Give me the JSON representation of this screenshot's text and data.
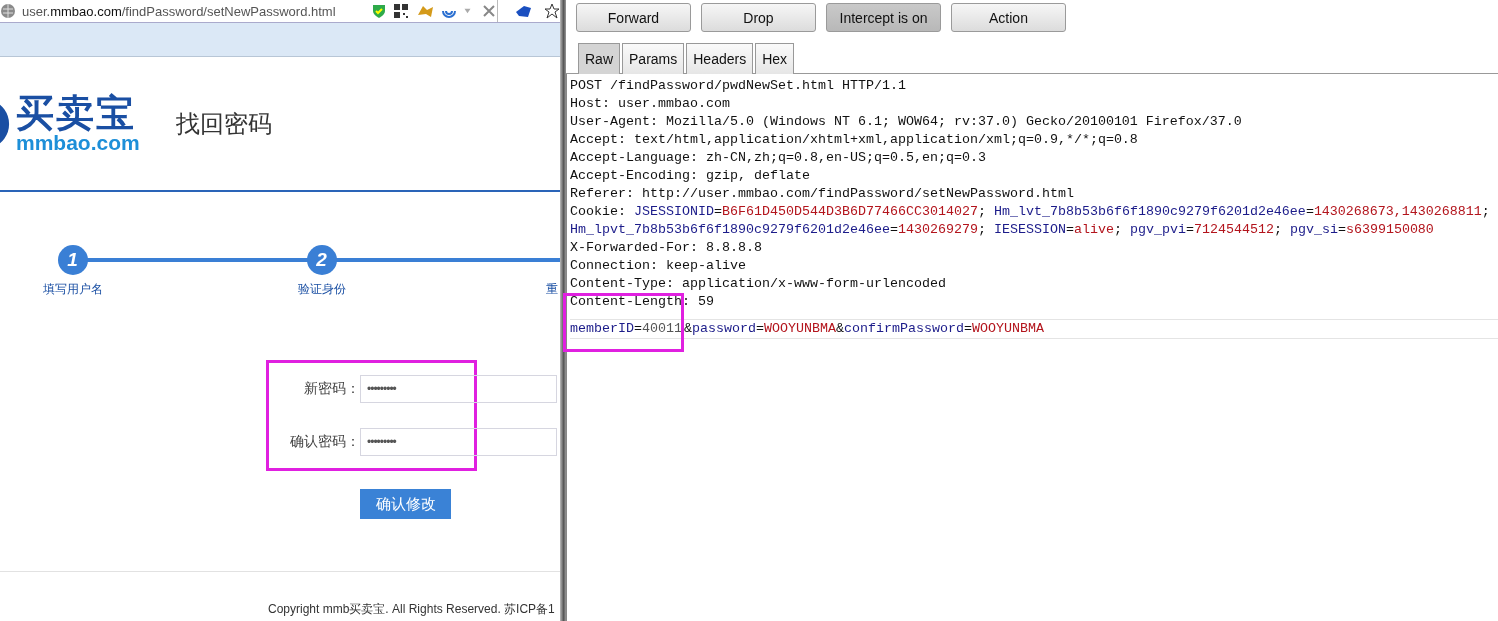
{
  "browser": {
    "url": "user.**mmbao.com**/findPassword/setNewPassword.html"
  },
  "page": {
    "logo": {
      "name": "买卖宝",
      "domain": "mmbao.com"
    },
    "heading": "找回密码",
    "steps": [
      {
        "number": "1",
        "label": "填写用户名"
      },
      {
        "number": "2",
        "label": "验证身份"
      },
      {
        "label": "重"
      }
    ],
    "form": {
      "highlighted": true,
      "fields": [
        {
          "label": "新密码：",
          "value": "•••••••••"
        },
        {
          "label": "确认密码：",
          "value": "•••••••••"
        }
      ],
      "submit": "确认修改"
    },
    "footer": "Copyright mmb买卖宝. All Rights Reserved. 苏ICP备1"
  },
  "proxy": {
    "buttons": [
      {
        "label": "Forward",
        "selected": false
      },
      {
        "label": "Drop",
        "selected": false
      },
      {
        "label": "Intercept is on",
        "selected": true
      },
      {
        "label": "Action",
        "selected": false
      }
    ],
    "tabs": [
      {
        "label": "Raw",
        "selected": true
      },
      {
        "label": "Params",
        "selected": false
      },
      {
        "label": "Headers",
        "selected": false
      },
      {
        "label": "Hex",
        "selected": false
      }
    ],
    "lines": [
      [
        {
          "text": "POST /findPassword/pwdNewSet.html HTTP/1.1",
          "kind": "plain"
        }
      ],
      [
        {
          "text": "Host: user.mmbao.com",
          "kind": "plain"
        }
      ],
      [
        {
          "text": "User-Agent: Mozilla/5.0 (Windows NT 6.1; WOW64; rv:37.0) Gecko/20100101 Firefox/37.0",
          "kind": "plain"
        }
      ],
      [
        {
          "text": "Accept: text/html,application/xhtml+xml,application/xml;q=0.9,*/*;q=0.8",
          "kind": "plain"
        }
      ],
      [
        {
          "text": "Accept-Language: zh-CN,zh;q=0.8,en-US;q=0.5,en;q=0.3",
          "kind": "plain"
        }
      ],
      [
        {
          "text": "Accept-Encoding: gzip, deflate",
          "kind": "plain"
        }
      ],
      [
        {
          "text": "Referer: http://user.mmbao.com/findPassword/setNewPassword.html",
          "kind": "plain"
        }
      ],
      [
        {
          "text": "Cookie: ",
          "kind": "plain"
        },
        {
          "text": "JSESSIONID",
          "kind": "key"
        },
        {
          "text": "=",
          "kind": "plain"
        },
        {
          "text": "B6F61D450D544D3B6D77466CC3014027",
          "kind": "value"
        },
        {
          "text": "; ",
          "kind": "plain"
        },
        {
          "text": "Hm_lvt_7b8b53b6f6f1890c9279f6201d2e46ee",
          "kind": "key"
        },
        {
          "text": "=",
          "kind": "plain"
        },
        {
          "text": "1430268673,1430268811",
          "kind": "value"
        },
        {
          "text": ";",
          "kind": "plain"
        }
      ],
      [
        {
          "text": "Hm_lpvt_7b8b53b6f6f1890c9279f6201d2e46ee",
          "kind": "key"
        },
        {
          "text": "=",
          "kind": "plain"
        },
        {
          "text": "1430269279",
          "kind": "value"
        },
        {
          "text": "; ",
          "kind": "plain"
        },
        {
          "text": "IESESSION",
          "kind": "key"
        },
        {
          "text": "=",
          "kind": "plain"
        },
        {
          "text": "alive",
          "kind": "value"
        },
        {
          "text": "; ",
          "kind": "plain"
        },
        {
          "text": "pgv_pvi",
          "kind": "key"
        },
        {
          "text": "=",
          "kind": "plain"
        },
        {
          "text": "7124544512",
          "kind": "value"
        },
        {
          "text": "; ",
          "kind": "plain"
        },
        {
          "text": "pgv_si",
          "kind": "key"
        },
        {
          "text": "=",
          "kind": "plain"
        },
        {
          "text": "s6399150080",
          "kind": "value"
        }
      ],
      [
        {
          "text": "X-Forwarded-For: 8.8.8.8",
          "kind": "plain"
        }
      ],
      [
        {
          "text": "Connection: keep-alive",
          "kind": "plain"
        }
      ],
      [
        {
          "text": "Content-Type: application/x-www-form-urlencoded",
          "kind": "plain"
        }
      ],
      [
        {
          "text": "Content-Length: 59",
          "kind": "plain"
        }
      ]
    ],
    "body": [
      {
        "highlighted": true,
        "segments": [
          {
            "text": "memberID",
            "kind": "key"
          },
          {
            "text": "=",
            "kind": "plain"
          },
          {
            "text": "40011",
            "kind": "number"
          }
        ]
      },
      {
        "highlighted": false,
        "segments": [
          {
            "text": "&",
            "kind": "plain"
          },
          {
            "text": "password",
            "kind": "key"
          },
          {
            "text": "=",
            "kind": "plain"
          },
          {
            "text": "WOOYUNBMA",
            "kind": "value"
          },
          {
            "text": "&",
            "kind": "plain"
          },
          {
            "text": "confirmPassword",
            "kind": "key"
          },
          {
            "text": "=",
            "kind": "plain"
          },
          {
            "text": "WOOYUNBMA",
            "kind": "value"
          }
        ]
      }
    ]
  }
}
